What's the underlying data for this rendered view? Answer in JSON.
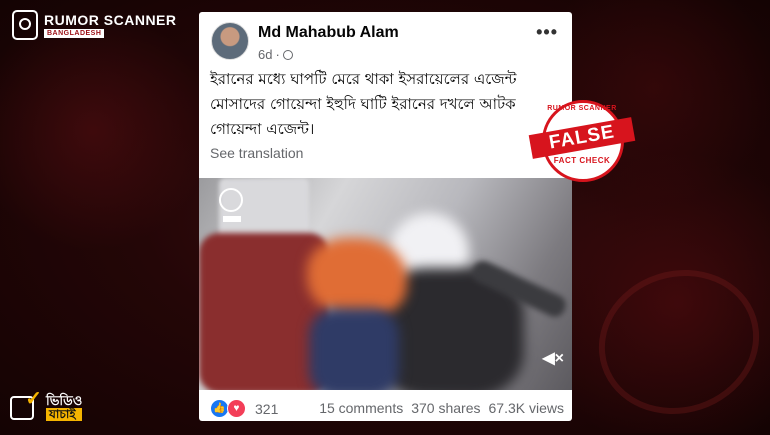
{
  "branding": {
    "name": "RUMOR SCANNER",
    "country": "BANGLADESH",
    "video_label_line1": "ভিডিও",
    "video_label_line2": "যাচাই"
  },
  "post": {
    "author": "Md Mahabub Alam",
    "time": "6d",
    "more_icon": "more-options-icon",
    "text": "ইরানের মধ্যে ঘাপটি মেরে থাকা ইসরায়েলের এজেন্ট মোসাদের গোয়েন্দা ইহুদি ঘাটি ইরানের দখলে আটক গোয়েন্দা এজেন্ট।",
    "see_translation": "See translation",
    "reactions_count": "321",
    "comments": "15 comments",
    "shares": "370 shares",
    "views": "67.3K views"
  },
  "verdict": {
    "top": "RUMOR SCANNER",
    "label": "FALSE",
    "bottom": "FACT CHECK",
    "color": "#d7141d"
  }
}
